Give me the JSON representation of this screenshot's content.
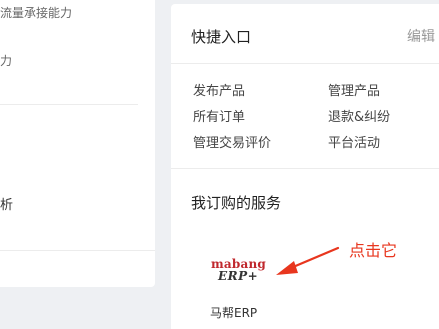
{
  "left_panel": {
    "text_1": "流量承接能力",
    "text_2": "力",
    "text_3": "析"
  },
  "quick_entry": {
    "title": "快捷入口",
    "edit_label": "编辑",
    "links": [
      {
        "label": "发布产品"
      },
      {
        "label": "管理产品"
      },
      {
        "label": "所有订单"
      },
      {
        "label": "退款&纠纷"
      },
      {
        "label": "管理交易评价"
      },
      {
        "label": "平台活动"
      }
    ]
  },
  "services": {
    "title": "我订购的服务",
    "items": [
      {
        "logo_line_1": "mabang",
        "logo_line_2": "ERP+",
        "name": "马帮ERP"
      }
    ]
  },
  "annotation": {
    "text": "点击它",
    "color": "#e8361e"
  },
  "colors": {
    "background": "#eef0f3",
    "card": "#ffffff",
    "brand_red": "#c0282d",
    "annotation_red": "#e8361e"
  }
}
